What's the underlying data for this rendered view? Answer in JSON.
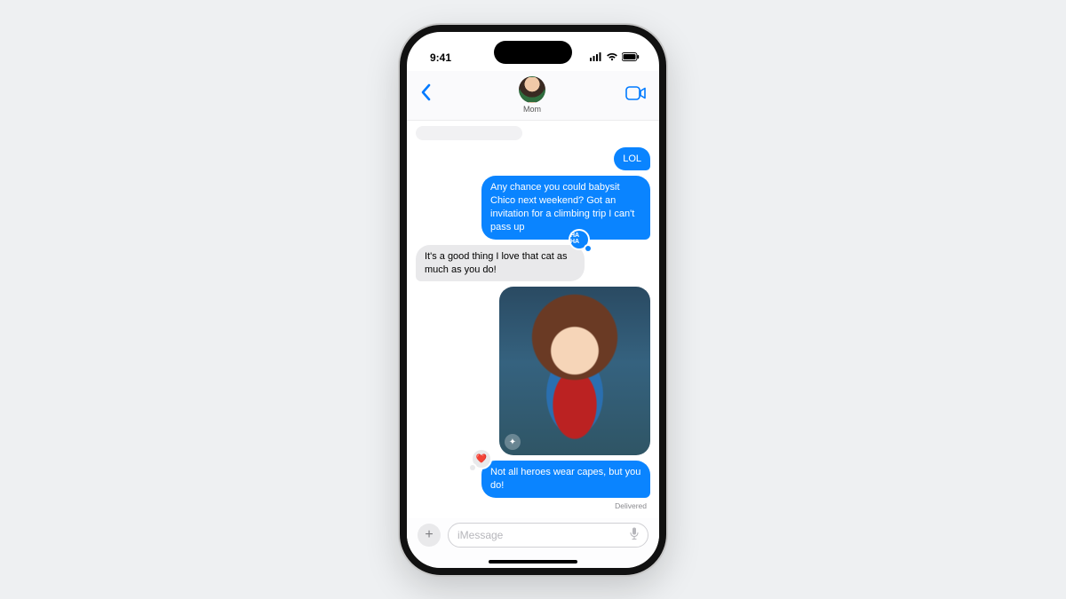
{
  "status": {
    "time": "9:41"
  },
  "nav": {
    "contact_name": "Mom"
  },
  "messages": {
    "m1": "LOL",
    "m2": "Any chance you could babysit Chico next weekend? Got an invitation for a climbing trip I can't pass up",
    "m3": "It's a good thing I love that cat as much as you do!",
    "m3_tapback_label": "HA HA",
    "m4_alt": "Stylized hero character illustration",
    "m5": "Not all heroes wear capes, but you do!",
    "m5_tapback": "❤️",
    "delivered": "Delivered"
  },
  "composer": {
    "placeholder": "iMessage"
  }
}
